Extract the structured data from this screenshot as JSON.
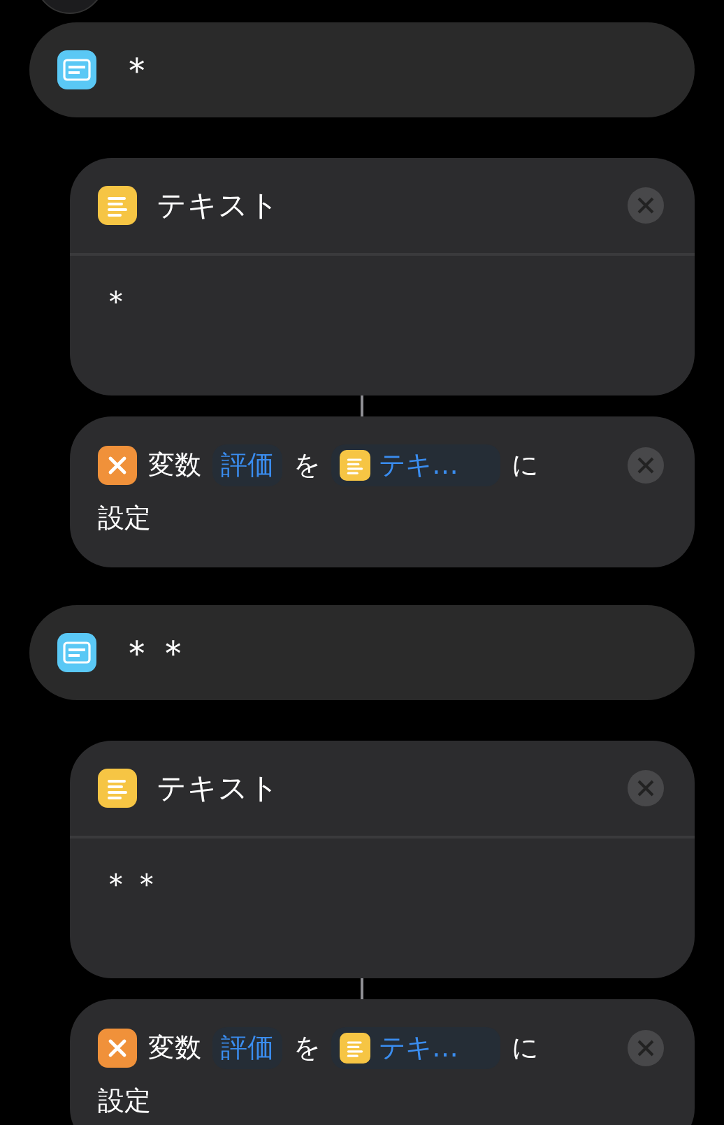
{
  "groups": [
    {
      "menu_case": {
        "label": "＊"
      },
      "text_action": {
        "title": "テキスト",
        "body": "＊"
      },
      "set_variable": {
        "verb": "変数",
        "variable": "評価",
        "particle": "を",
        "value": "テキ…",
        "suffix": "に",
        "end": "設定"
      }
    },
    {
      "menu_case": {
        "label": "＊＊"
      },
      "text_action": {
        "title": "テキスト",
        "body": "＊＊"
      },
      "set_variable": {
        "verb": "変数",
        "variable": "評価",
        "particle": "を",
        "value": "テキ…",
        "suffix": "に",
        "end": "設定"
      }
    }
  ]
}
